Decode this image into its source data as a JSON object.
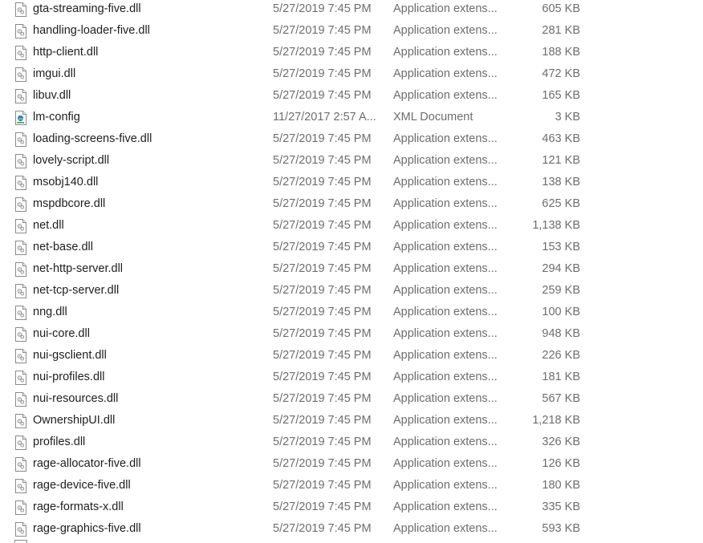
{
  "files": [
    {
      "name": "gta-streaming-five.dll",
      "date": "5/27/2019 7:45 PM",
      "type": "Application extens...",
      "size": "605 KB",
      "icon": "dll-file-icon"
    },
    {
      "name": "handling-loader-five.dll",
      "date": "5/27/2019 7:45 PM",
      "type": "Application extens...",
      "size": "281 KB",
      "icon": "dll-file-icon"
    },
    {
      "name": "http-client.dll",
      "date": "5/27/2019 7:45 PM",
      "type": "Application extens...",
      "size": "188 KB",
      "icon": "dll-file-icon"
    },
    {
      "name": "imgui.dll",
      "date": "5/27/2019 7:45 PM",
      "type": "Application extens...",
      "size": "472 KB",
      "icon": "dll-file-icon"
    },
    {
      "name": "libuv.dll",
      "date": "5/27/2019 7:45 PM",
      "type": "Application extens...",
      "size": "165 KB",
      "icon": "dll-file-icon"
    },
    {
      "name": "lm-config",
      "date": "11/27/2017 2:57 A...",
      "type": "XML Document",
      "size": "3 KB",
      "icon": "xml-document-icon"
    },
    {
      "name": "loading-screens-five.dll",
      "date": "5/27/2019 7:45 PM",
      "type": "Application extens...",
      "size": "463 KB",
      "icon": "dll-file-icon"
    },
    {
      "name": "lovely-script.dll",
      "date": "5/27/2019 7:45 PM",
      "type": "Application extens...",
      "size": "121 KB",
      "icon": "dll-file-icon"
    },
    {
      "name": "msobj140.dll",
      "date": "5/27/2019 7:45 PM",
      "type": "Application extens...",
      "size": "138 KB",
      "icon": "dll-file-icon"
    },
    {
      "name": "mspdbcore.dll",
      "date": "5/27/2019 7:45 PM",
      "type": "Application extens...",
      "size": "625 KB",
      "icon": "dll-file-icon"
    },
    {
      "name": "net.dll",
      "date": "5/27/2019 7:45 PM",
      "type": "Application extens...",
      "size": "1,138 KB",
      "icon": "dll-file-icon"
    },
    {
      "name": "net-base.dll",
      "date": "5/27/2019 7:45 PM",
      "type": "Application extens...",
      "size": "153 KB",
      "icon": "dll-file-icon"
    },
    {
      "name": "net-http-server.dll",
      "date": "5/27/2019 7:45 PM",
      "type": "Application extens...",
      "size": "294 KB",
      "icon": "dll-file-icon"
    },
    {
      "name": "net-tcp-server.dll",
      "date": "5/27/2019 7:45 PM",
      "type": "Application extens...",
      "size": "259 KB",
      "icon": "dll-file-icon"
    },
    {
      "name": "nng.dll",
      "date": "5/27/2019 7:45 PM",
      "type": "Application extens...",
      "size": "100 KB",
      "icon": "dll-file-icon"
    },
    {
      "name": "nui-core.dll",
      "date": "5/27/2019 7:45 PM",
      "type": "Application extens...",
      "size": "948 KB",
      "icon": "dll-file-icon"
    },
    {
      "name": "nui-gsclient.dll",
      "date": "5/27/2019 7:45 PM",
      "type": "Application extens...",
      "size": "226 KB",
      "icon": "dll-file-icon"
    },
    {
      "name": "nui-profiles.dll",
      "date": "5/27/2019 7:45 PM",
      "type": "Application extens...",
      "size": "181 KB",
      "icon": "dll-file-icon"
    },
    {
      "name": "nui-resources.dll",
      "date": "5/27/2019 7:45 PM",
      "type": "Application extens...",
      "size": "567 KB",
      "icon": "dll-file-icon"
    },
    {
      "name": "OwnershipUI.dll",
      "date": "5/27/2019 7:45 PM",
      "type": "Application extens...",
      "size": "1,218 KB",
      "icon": "dll-file-icon"
    },
    {
      "name": "profiles.dll",
      "date": "5/27/2019 7:45 PM",
      "type": "Application extens...",
      "size": "326 KB",
      "icon": "dll-file-icon"
    },
    {
      "name": "rage-allocator-five.dll",
      "date": "5/27/2019 7:45 PM",
      "type": "Application extens...",
      "size": "126 KB",
      "icon": "dll-file-icon"
    },
    {
      "name": "rage-device-five.dll",
      "date": "5/27/2019 7:45 PM",
      "type": "Application extens...",
      "size": "180 KB",
      "icon": "dll-file-icon"
    },
    {
      "name": "rage-formats-x.dll",
      "date": "5/27/2019 7:45 PM",
      "type": "Application extens...",
      "size": "335 KB",
      "icon": "dll-file-icon"
    },
    {
      "name": "rage-graphics-five.dll",
      "date": "5/27/2019 7:45 PM",
      "type": "Application extens...",
      "size": "593 KB",
      "icon": "dll-file-icon"
    }
  ]
}
